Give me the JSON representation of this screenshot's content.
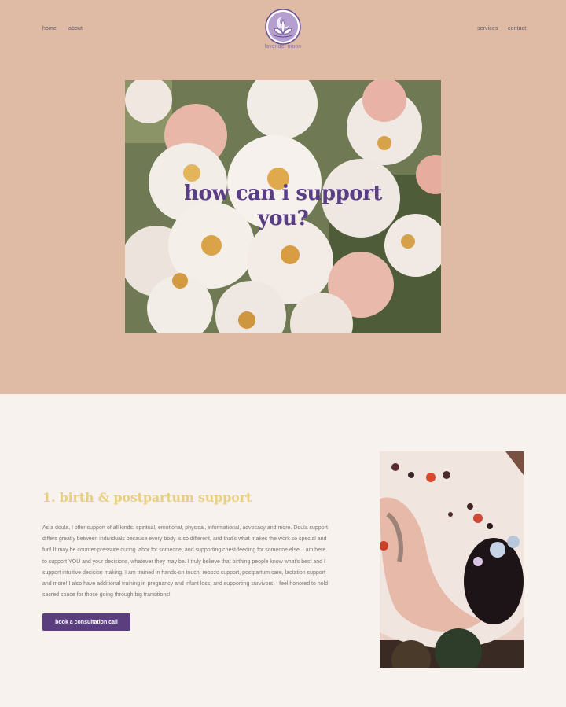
{
  "nav": {
    "left": [
      {
        "label": "home"
      },
      {
        "label": "about"
      }
    ],
    "right": [
      {
        "label": "services"
      },
      {
        "label": "contact"
      }
    ]
  },
  "logo": {
    "text": "lavender moon",
    "icon": "lotus-moon-logo-icon"
  },
  "hero": {
    "title_line1": "how can i support",
    "title_line2": "you?",
    "image": "white-roses-photo"
  },
  "service": {
    "title": "1. birth & postpartum support",
    "description": "As a doula, I offer support of all kinds: spiritual, emotional, physical, informational, advocacy and more. Doula support differs greatly between individuals because every body is so different, and that's what makes the work so special and fun! It may be counter-pressure during labor for someone, and supporting chest-feeding for someone else. I am here to support YOU and your decisions, whatever they may be. I truly believe that birthing people know what's best and I support intuitive decision making. I am trained in hands-on touch, rebozo support, postpartum care, lactation support and more! I also have additional training in pregnancy and infant loss, and supporting survivors. I feel honored to hold sacred space for those going through big transitions!",
    "button_label": "book a consultation call",
    "image": "flower-bath-photo"
  },
  "colors": {
    "hero_bg": "#dfbba5",
    "page_bg": "#f8f2ef",
    "accent_purple": "#5a3e7e",
    "title_gold": "#e8cf82"
  }
}
